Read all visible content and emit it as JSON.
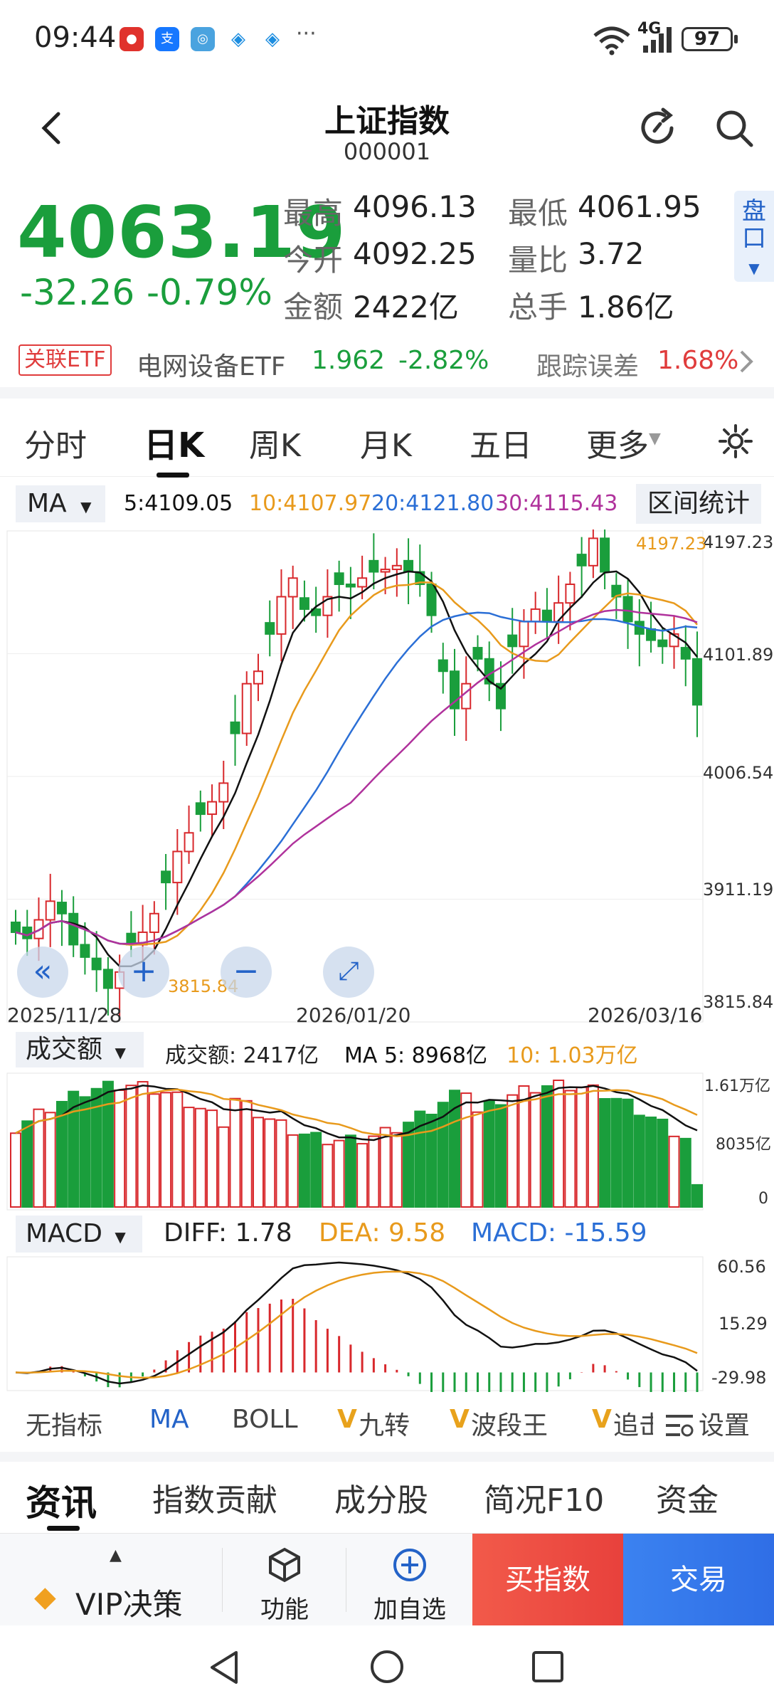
{
  "status_bar": {
    "time": "09:44",
    "network": "4G",
    "battery": "97",
    "icons": [
      "app-icon-1",
      "alipay-icon",
      "app-icon-3",
      "app-icon-4",
      "app-icon-5"
    ],
    "more": "···"
  },
  "header": {
    "back_icon": "chevron-left-icon",
    "title": "上证指数",
    "code": "000001",
    "refresh_icon": "refresh-icon",
    "search_icon": "search-icon"
  },
  "quote": {
    "price": "4063.19",
    "change": "-32.26",
    "change_pct": "-0.79%",
    "high_label": "最高",
    "high": "4096.13",
    "low_label": "最低",
    "low": "4061.95",
    "open_label": "今开",
    "open": "4092.25",
    "ratio_label": "量比",
    "ratio": "3.72",
    "amount_label": "金额",
    "amount": "2422亿",
    "turnover_label": "总手",
    "turnover": "1.86亿",
    "pankou": "盘口"
  },
  "etf": {
    "badge": "关联ETF",
    "name": "电网设备ETF",
    "price": "1.962",
    "change_pct": "-2.82%",
    "tracking_label": "跟踪误差",
    "tracking_value": "1.68%"
  },
  "period_tabs": [
    "分时",
    "日K",
    "周K",
    "月K",
    "五日",
    "更多"
  ],
  "ma_legend": {
    "selector": "MA",
    "ma5": "5:4109.05",
    "ma10": "10:4107.97",
    "ma20": "20:4121.80",
    "ma30": "30:4115.43",
    "range_button": "区间统计"
  },
  "kline_axis": {
    "y_labels": [
      "4197.23",
      "4101.89",
      "4006.54",
      "3911.19",
      "3815.84"
    ],
    "dates": [
      "2025/11/28",
      "2026/01/20",
      "2026/03/16"
    ],
    "max_marker": "4197.23",
    "min_marker": "3815.84"
  },
  "volume": {
    "selector": "成交额",
    "amount": "成交额: 2417亿",
    "ma5": "MA 5: 8968亿",
    "ma10": "10: 1.03万亿",
    "y_labels": [
      "1.61万亿",
      "8035亿",
      "0"
    ]
  },
  "macd": {
    "selector": "MACD",
    "diff": "DIFF: 1.78",
    "dea": "DEA: 9.58",
    "macd": "MACD: -15.59",
    "y_labels": [
      "60.56",
      "15.29",
      "-29.98"
    ]
  },
  "indicator_tabs": [
    "无指标",
    "MA",
    "BOLL",
    "九转",
    "波段王",
    "追击"
  ],
  "indicator_settings": "设置",
  "info_tabs": [
    "资讯",
    "指数贡献",
    "成分股",
    "简况F10",
    "资金"
  ],
  "bottom_bar": {
    "vip": "VIP决策",
    "function": "功能",
    "add_watch": "加自选",
    "buy": "买指数",
    "trade": "交易"
  },
  "colors": {
    "up": "#d8282c",
    "down": "#1a9e3c",
    "ma5": "#111111",
    "ma10": "#e89a1c",
    "ma20": "#2b6fd6",
    "ma30": "#b0329c",
    "accent_blue": "#2463c8"
  },
  "chart_data": {
    "type": "candlestick",
    "series": [
      {
        "name": "日K",
        "close_approx": [
          3880,
          3875,
          3890,
          3905,
          3895,
          3870,
          3860,
          3850,
          3835,
          3848,
          3870,
          3880,
          3895,
          3920,
          3945,
          3960,
          3975,
          3985,
          4000,
          4040,
          4080,
          4090,
          4120,
          4150,
          4165,
          4140,
          4135,
          4150,
          4160,
          4158,
          4165,
          4170,
          4172,
          4175,
          4170,
          4160,
          4135,
          4090,
          4060,
          4080,
          4100,
          4080,
          4060,
          4110,
          4130,
          4140,
          4130,
          4145,
          4160,
          4175,
          4197,
          4170,
          4150,
          4130,
          4120,
          4115,
          4110,
          4120,
          4100,
          4063
        ]
      }
    ]
  }
}
